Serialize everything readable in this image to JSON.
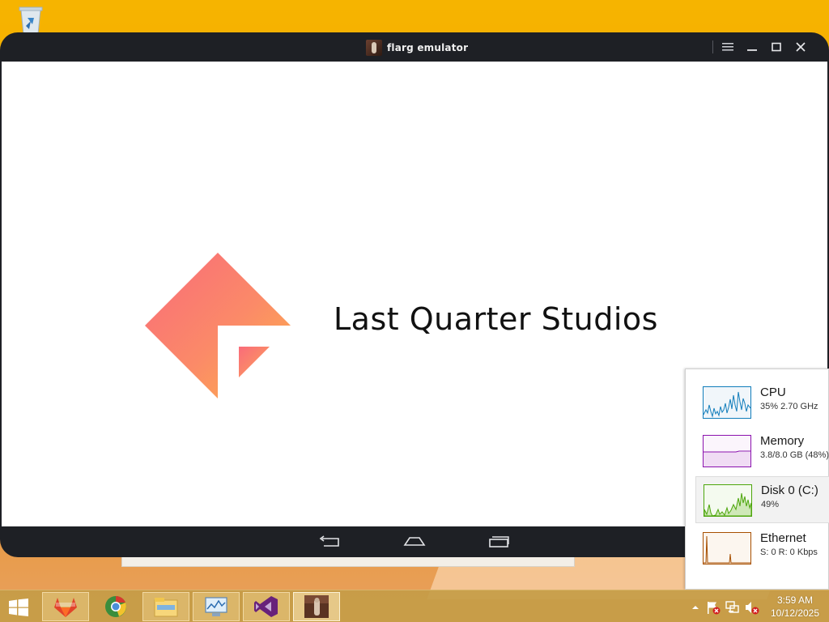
{
  "emulator": {
    "title": "flarg emulator",
    "controls": {
      "menu": "menu-icon",
      "minimize": "minimize-icon",
      "maximize": "maximize-icon",
      "close": "close-icon"
    },
    "screen": {
      "studio_name": "Last Quarter Studios"
    },
    "navbar": {
      "back": "back-icon",
      "home": "home-icon",
      "recents": "recents-icon"
    }
  },
  "performance": {
    "items": [
      {
        "name": "CPU",
        "detail": "35% 2.70 GHz",
        "color": "#117dbb",
        "selected": false
      },
      {
        "name": "Memory",
        "detail": "3.8/8.0 GB (48%)",
        "color": "#8b12ae",
        "selected": false
      },
      {
        "name": "Disk 0 (C:)",
        "detail": "49%",
        "color": "#4da60c",
        "selected": true
      },
      {
        "name": "Ethernet",
        "detail": "S: 0 R: 0 Kbps",
        "color": "#a74f01",
        "selected": false
      }
    ]
  },
  "taskbar": {
    "apps": [
      "gitlab-icon",
      "chrome-icon",
      "file-explorer-icon",
      "resource-monitor-icon",
      "visual-studio-icon",
      "flarg-emulator-icon"
    ],
    "tray": [
      "show-hidden-icons-chevron",
      "action-center-flag-icon",
      "network-icon",
      "volume-muted-icon"
    ],
    "clock": {
      "time": "3:59 AM",
      "date": "10/12/2025"
    }
  }
}
